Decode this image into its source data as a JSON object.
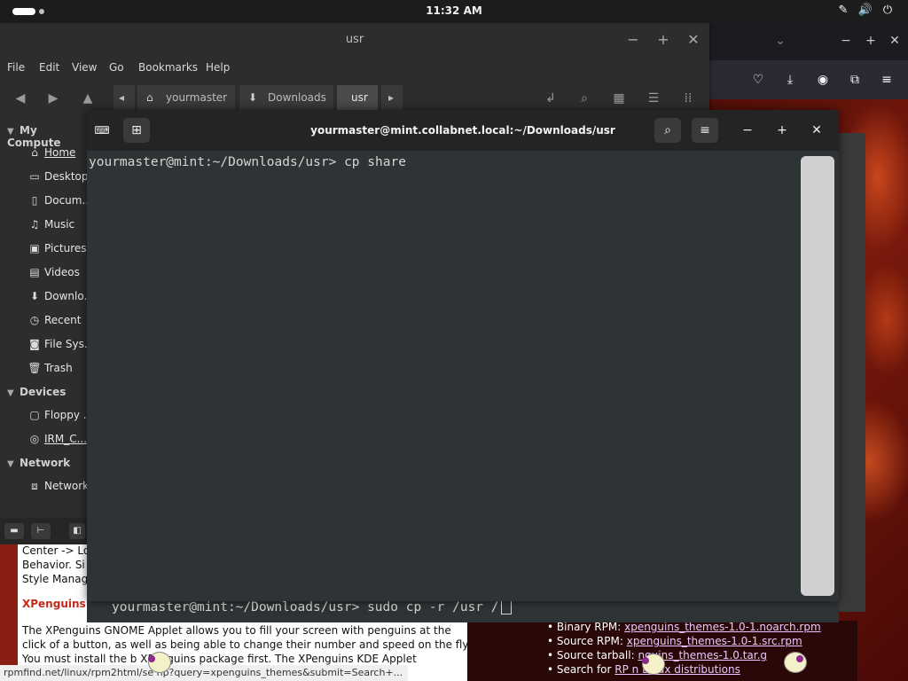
{
  "top_panel": {
    "clock": "11:32 AM",
    "tray_icons": [
      "pen-icon",
      "volume-icon",
      "power-icon"
    ]
  },
  "file_manager": {
    "title": "usr",
    "menu": [
      "File",
      "Edit",
      "View",
      "Go",
      "Bookmarks",
      "Help"
    ],
    "breadcrumbs": [
      "yourmaster",
      "Downloads",
      "usr"
    ],
    "sidebar": {
      "my_computer_label": "My Compute",
      "my_computer_items": [
        "Home",
        "Desktop",
        "Docum...",
        "Music",
        "Pictures",
        "Videos",
        "Downlo...",
        "Recent",
        "File Sys...",
        "Trash"
      ],
      "devices_label": "Devices",
      "devices_items": [
        "Floppy ...",
        "IRM_C..."
      ],
      "network_label": "Network",
      "network_items": [
        "Network"
      ]
    }
  },
  "terminal": {
    "title": "yourmaster@mint.collabnet.local:~/Downloads/usr",
    "line1": "yourmaster@mint:~/Downloads/usr> cp share",
    "line2": "yourmaster@mint:~/Downloads/usr> sudo cp -r /usr /"
  },
  "webpage": {
    "lines_top": [
      "Center -> Lo",
      "Behavior. Si",
      "Style Manag"
    ],
    "heading": "XPenguins GNO",
    "para": [
      "The XPenguins GNOME Applet allows you to fill your screen with penguins at the",
      "click of a button, as well as being able to change their number and speed on the fly.",
      "You must install the b     XPenguins package first. The XPenguins KDE Applet"
    ],
    "downloads": [
      {
        "label": "Binary RPM:",
        "link": "xpenguins_themes-1.0-1.noarch.rpm"
      },
      {
        "label": "Source RPM:",
        "link": "xpenguins_themes-1.0-1.src.rpm"
      },
      {
        "label": "Source tarball:",
        "link": "nguins_themes-1.0.tar.g"
      },
      {
        "label": "Search for",
        "link": "RP     n Linux distributions"
      }
    ],
    "status_url": "rpmfind.net/linux/rpm2html/se     hp?query=xpenguins_themes&submit=Search+..."
  }
}
